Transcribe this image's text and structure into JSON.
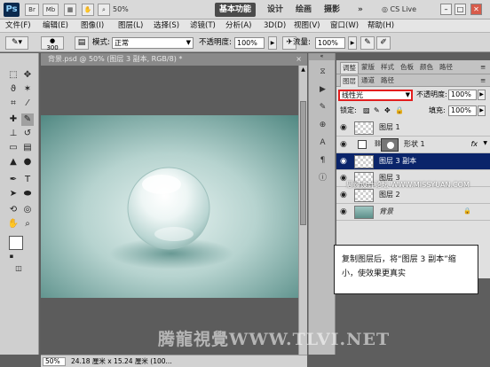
{
  "titlebar": {
    "logo": "Ps",
    "buttons": [
      "Br",
      "Mb"
    ],
    "zoom": "50%",
    "workspaces": [
      "基本功能",
      "设计",
      "绘画",
      "摄影"
    ],
    "more": "»",
    "cslive": "CS Live",
    "win_min": "–",
    "win_max": "□",
    "win_close": "✕"
  },
  "menu": [
    "文件(F)",
    "编辑(E)",
    "图像(I)",
    "图层(L)",
    "选择(S)",
    "滤镜(T)",
    "分析(A)",
    "3D(D)",
    "视图(V)",
    "窗口(W)",
    "帮助(H)"
  ],
  "options": {
    "brush_size": "300",
    "mode_label": "模式:",
    "mode_value": "正常",
    "opacity_label": "不透明度:",
    "opacity_value": "100%",
    "flow_label": "流量:",
    "flow_value": "100%"
  },
  "document": {
    "tab_title": "背景.psd @ 50% (图层 3 副本, RGB/8) *",
    "status_zoom": "50%",
    "status_info": "24.18 厘米 x 15.24 厘米 (100..."
  },
  "panels": {
    "top_tabs": [
      "调整",
      "蒙版",
      "样式",
      "色板",
      "颜色",
      "路径"
    ],
    "layer_tabs": [
      "图层",
      "通道",
      "路径"
    ],
    "blend_mode": "线性光",
    "opacity_label": "不透明度:",
    "opacity_value": "100%",
    "lock_label": "锁定:",
    "fill_label": "填充:",
    "fill_value": "100%",
    "layers": [
      {
        "name": "图层 1",
        "selected": false,
        "type": "normal"
      },
      {
        "name": "形状 1",
        "selected": false,
        "type": "shape",
        "fx": "fx"
      },
      {
        "name": "图层 3 副本",
        "selected": true,
        "type": "normal"
      },
      {
        "name": "图层 3",
        "selected": false,
        "type": "normal"
      },
      {
        "name": "图层 2",
        "selected": false,
        "type": "normal"
      },
      {
        "name": "背景",
        "selected": false,
        "type": "background"
      }
    ]
  },
  "watermark": "思缘设计论坛 WWW.MISSYUAN.COM",
  "tooltip": "复制图层后，将“图层 3 副本”缩小，使效果更真实",
  "footer_brand": "腾龍視覺WWW.TLVI.NET"
}
